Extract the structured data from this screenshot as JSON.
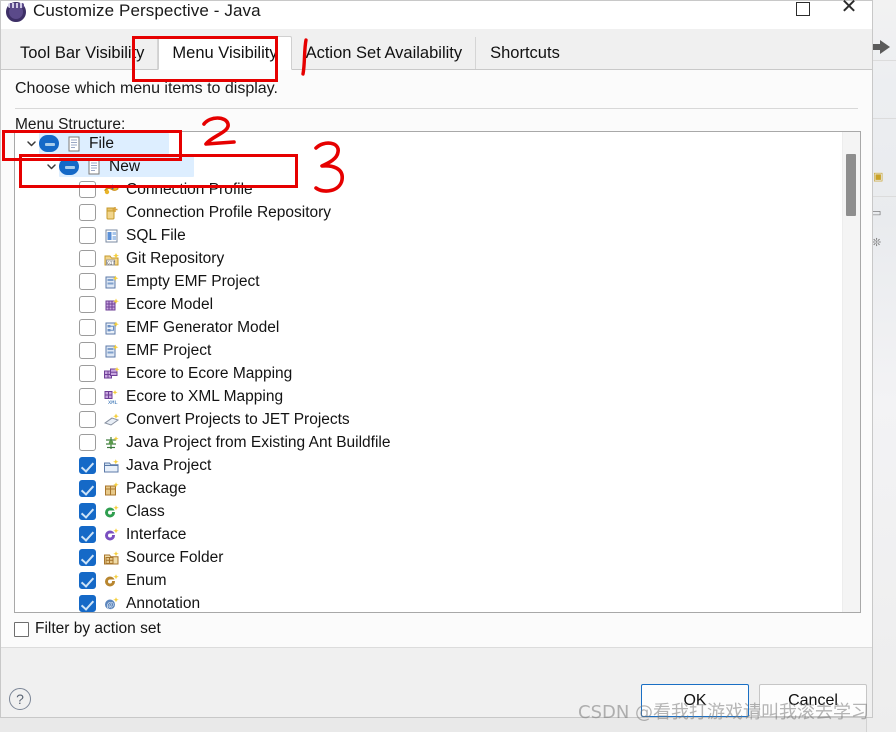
{
  "window": {
    "title": "Customize Perspective - Java",
    "icon": "eclipse-icon",
    "minimize_label": "—",
    "maximize_label": "□",
    "close_label": "✕"
  },
  "tabs": [
    {
      "label": "Tool Bar Visibility",
      "active": false
    },
    {
      "label": "Menu Visibility",
      "active": true
    },
    {
      "label": "Action Set Availability",
      "active": false
    },
    {
      "label": "Shortcuts",
      "active": false
    }
  ],
  "description": "Choose which menu items to display.",
  "tree": {
    "label": "Menu Structure:",
    "rows": [
      {
        "label": "File",
        "depth": 0,
        "twisty": "chevron-down",
        "check": "grayed",
        "icon": "menu-icon",
        "selected": true
      },
      {
        "label": "New",
        "depth": 1,
        "twisty": "chevron-down",
        "check": "grayed",
        "icon": "menu-icon",
        "selected": true
      },
      {
        "label": "Connection Profile",
        "depth": 2,
        "twisty": "none",
        "check": "unchecked",
        "icon": "connection-profile-icon",
        "selected": false
      },
      {
        "label": "Connection Profile Repository",
        "depth": 2,
        "twisty": "none",
        "check": "unchecked",
        "icon": "repository-icon",
        "selected": false
      },
      {
        "label": "SQL File",
        "depth": 2,
        "twisty": "none",
        "check": "unchecked",
        "icon": "sql-file-icon",
        "selected": false
      },
      {
        "label": "Git Repository",
        "depth": 2,
        "twisty": "none",
        "check": "unchecked",
        "icon": "git-repo-icon",
        "selected": false
      },
      {
        "label": "Empty EMF Project",
        "depth": 2,
        "twisty": "none",
        "check": "unchecked",
        "icon": "emf-project-icon",
        "selected": false
      },
      {
        "label": "Ecore Model",
        "depth": 2,
        "twisty": "none",
        "check": "unchecked",
        "icon": "ecore-model-icon",
        "selected": false
      },
      {
        "label": "EMF Generator Model",
        "depth": 2,
        "twisty": "none",
        "check": "unchecked",
        "icon": "emf-genmodel-icon",
        "selected": false
      },
      {
        "label": "EMF Project",
        "depth": 2,
        "twisty": "none",
        "check": "unchecked",
        "icon": "emf-project-icon",
        "selected": false
      },
      {
        "label": "Ecore to Ecore Mapping",
        "depth": 2,
        "twisty": "none",
        "check": "unchecked",
        "icon": "ecore-mapping-icon",
        "selected": false
      },
      {
        "label": "Ecore to XML Mapping",
        "depth": 2,
        "twisty": "none",
        "check": "unchecked",
        "icon": "ecore-xml-icon",
        "selected": false
      },
      {
        "label": "Convert Projects to JET Projects",
        "depth": 2,
        "twisty": "none",
        "check": "unchecked",
        "icon": "jet-convert-icon",
        "selected": false
      },
      {
        "label": "Java Project from Existing Ant Buildfile",
        "depth": 2,
        "twisty": "none",
        "check": "unchecked",
        "icon": "ant-buildfile-icon",
        "selected": false
      },
      {
        "label": "Java Project",
        "depth": 2,
        "twisty": "none",
        "check": "checked",
        "icon": "java-project-icon",
        "selected": false
      },
      {
        "label": "Package",
        "depth": 2,
        "twisty": "none",
        "check": "checked",
        "icon": "package-icon",
        "selected": false
      },
      {
        "label": "Class",
        "depth": 2,
        "twisty": "none",
        "check": "checked",
        "icon": "class-icon",
        "selected": false
      },
      {
        "label": "Interface",
        "depth": 2,
        "twisty": "none",
        "check": "checked",
        "icon": "interface-icon",
        "selected": false
      },
      {
        "label": "Source Folder",
        "depth": 2,
        "twisty": "none",
        "check": "checked",
        "icon": "source-folder-icon",
        "selected": false
      },
      {
        "label": "Enum",
        "depth": 2,
        "twisty": "none",
        "check": "checked",
        "icon": "enum-icon",
        "selected": false
      },
      {
        "label": "Annotation",
        "depth": 2,
        "twisty": "none",
        "check": "checked",
        "icon": "annotation-icon",
        "selected": false
      }
    ]
  },
  "filter": {
    "label": "Filter by action set",
    "checked": false
  },
  "footer": {
    "help_label": "?",
    "ok_label": "OK",
    "cancel_label": "Cancel"
  },
  "annotations": {
    "mark_two": "2",
    "mark_three": "3"
  },
  "watermark": "CSDN @看我打游戏请叫我滚去学习",
  "colors": {
    "accent": "#1569c7",
    "annotation_red": "#e60000",
    "selection": "#ddeeff",
    "primary_button_border": "#1a6fc4"
  }
}
